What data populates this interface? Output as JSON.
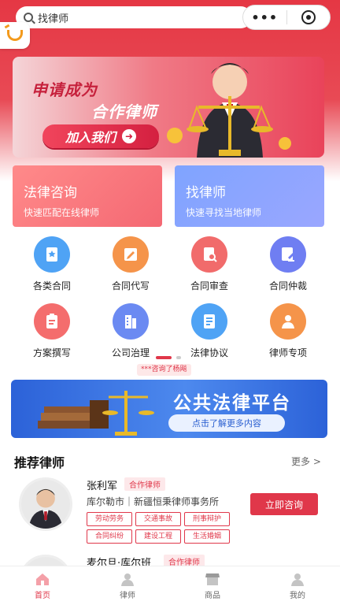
{
  "search": {
    "text": "找律师"
  },
  "capsule": {
    "more": "•••",
    "icon": "target-icon"
  },
  "banner": {
    "line1": "申请成为",
    "line2": "合作律师",
    "button": "加入我们"
  },
  "cards": [
    {
      "title": "法律咨询",
      "subtitle": "快速匹配在线律师"
    },
    {
      "title": "找律师",
      "subtitle": "快速寻找当地律师"
    }
  ],
  "services": [
    {
      "label": "各类合同",
      "color": "#4fa3f5",
      "icon": "contract-icon"
    },
    {
      "label": "合同代写",
      "color": "#f5944a",
      "icon": "pen-icon"
    },
    {
      "label": "合同审查",
      "color": "#f16b6b",
      "icon": "review-icon"
    },
    {
      "label": "合同仲裁",
      "color": "#6f7ef2",
      "icon": "arbitration-icon"
    },
    {
      "label": "方案撰写",
      "color": "#f46d6d",
      "icon": "clipboard-icon"
    },
    {
      "label": "公司治理",
      "color": "#6b8af2",
      "icon": "building-icon"
    },
    {
      "label": "法律协议",
      "color": "#4fa3f5",
      "icon": "document-icon"
    },
    {
      "label": "律师专项",
      "color": "#f5944a",
      "icon": "person-icon"
    }
  ],
  "ticker": "***咨询了杨飚",
  "platform": {
    "title": "公共法律平台",
    "button": "点击了解更多内容"
  },
  "recommend": {
    "title": "推荐律师",
    "more": "更多"
  },
  "lawyers": [
    {
      "name": "张利军",
      "tag": "合作律师",
      "firm": "库尔勒市｜新疆恒秉律师事务所",
      "chips": [
        "劳动劳务",
        "交通事故",
        "刑事辩护",
        "合同纠纷",
        "建设工程",
        "生活婚姻"
      ],
      "button": "立即咨询"
    },
    {
      "name": "麦尔旦·库尔班",
      "tag": "合作律师"
    }
  ],
  "tabs": [
    {
      "label": "首页",
      "icon": "home-icon",
      "active": true
    },
    {
      "label": "律师",
      "icon": "lawyer-icon",
      "active": false
    },
    {
      "label": "商品",
      "icon": "shop-icon",
      "active": false
    },
    {
      "label": "我的",
      "icon": "user-icon",
      "active": false
    }
  ],
  "colors": {
    "primary": "#e0374a",
    "blue": "#2c62d8"
  }
}
